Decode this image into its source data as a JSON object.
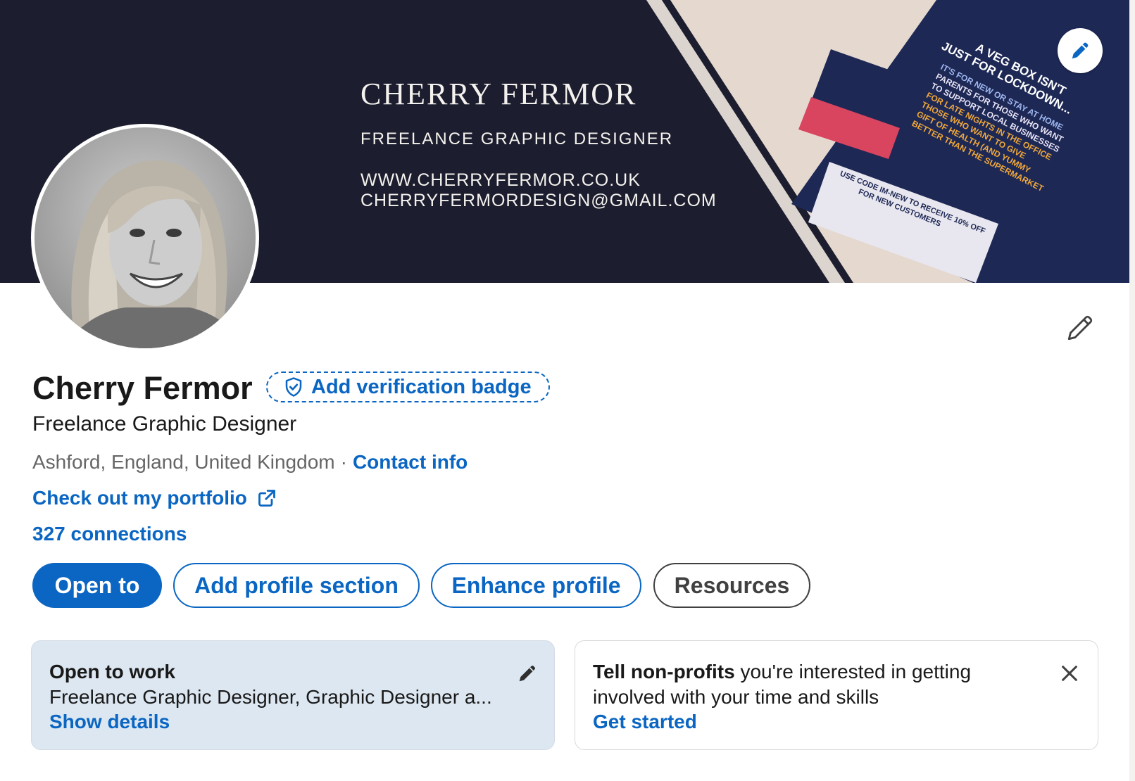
{
  "banner": {
    "name": "CHERRY FERMOR",
    "role": "FREELANCE GRAPHIC DESIGNER",
    "website": "WWW.CHERRYFERMOR.CO.UK",
    "email": "CHERRYFERMORDESIGN@GMAIL.COM",
    "flyer_lines": [
      "A VEG BOX ISN'T",
      "JUST FOR LOCKDOWN...",
      "IT'S FOR NEW OR STAY AT HOME",
      "PARENTS FOR THOSE WHO WANT",
      "TO SUPPORT LOCAL BUSINESSES",
      "FOR LATE NIGHTS IN THE OFFICE",
      "THOSE WHO WANT TO GIVE",
      "GIFT OF HEALTH (AND YUMMY",
      "BETTER THAN THE SUPERMARKET"
    ],
    "flyer_code": "USE CODE IM-NEW TO RECEIVE 10% OFF",
    "flyer_code2": "FOR NEW CUSTOMERS",
    "edit_icon": "pencil-icon"
  },
  "profile": {
    "name": "Cherry Fermor",
    "verification_label": "Add verification badge",
    "headline": "Freelance Graphic Designer",
    "location": "Ashford, England, United Kingdom",
    "separator": "·",
    "contact_label": "Contact info",
    "portfolio_label": "Check out my portfolio",
    "connections_label": "327 connections"
  },
  "actions": {
    "open_to": "Open to",
    "add_section": "Add profile section",
    "enhance": "Enhance profile",
    "resources": "Resources"
  },
  "open_to_work": {
    "title": "Open to work",
    "description": "Freelance Graphic Designer, Graphic Designer a...",
    "link": "Show details"
  },
  "nonprofit": {
    "bold": "Tell non-profits",
    "rest": " you're interested in getting",
    "line2": "involved with your time and skills",
    "link": "Get started"
  },
  "colors": {
    "brand_blue": "#0a66c2",
    "banner_navy": "#1c1d2e",
    "card_blue_tint": "#dde7f1"
  }
}
